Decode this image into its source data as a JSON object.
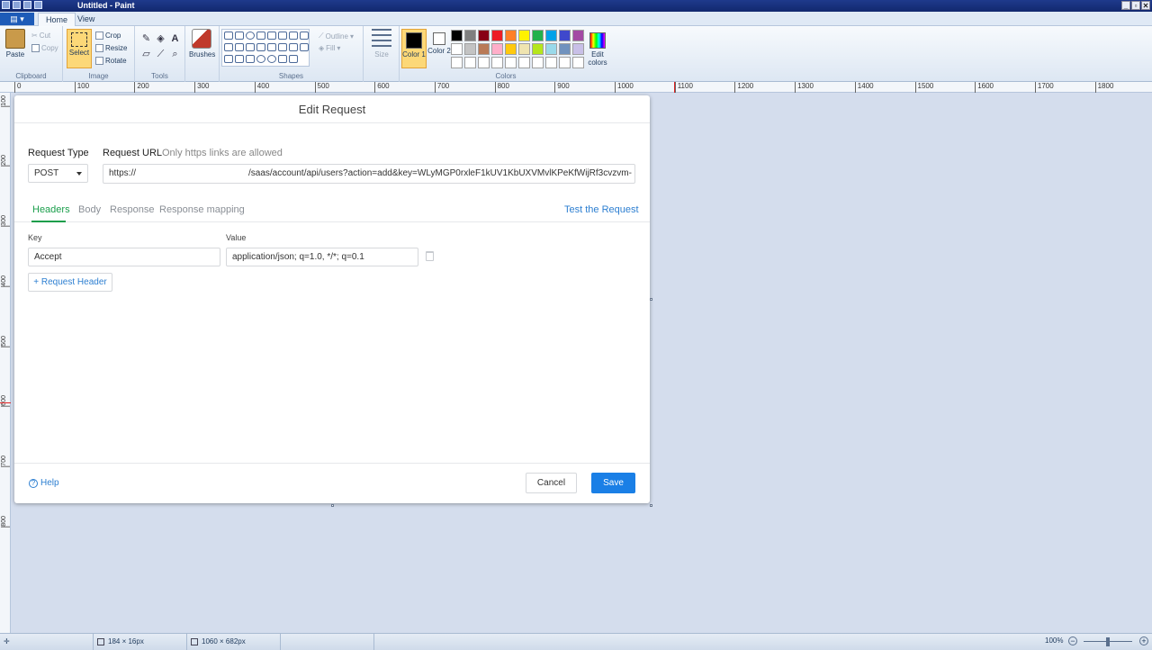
{
  "window": {
    "title": "Untitled - Paint",
    "controls": [
      "_",
      "▫",
      "✕"
    ]
  },
  "ribbon": {
    "file_menu_icon": "paint-menu-icon",
    "tabs": [
      {
        "label": "Home",
        "active": true
      },
      {
        "label": "View",
        "active": false
      }
    ],
    "groups": {
      "clipboard": {
        "label": "Clipboard",
        "paste": "Paste",
        "cut": "Cut",
        "copy": "Copy"
      },
      "image": {
        "label": "Image",
        "select": "Select",
        "crop": "Crop",
        "resize": "Resize",
        "rotate": "Rotate"
      },
      "tools": {
        "label": "Tools"
      },
      "brushes": {
        "label": "Brushes"
      },
      "shapes": {
        "label": "Shapes",
        "outline": "Outline",
        "fill": "Fill"
      },
      "size": {
        "label": "Size"
      },
      "colors": {
        "label": "Colors",
        "color1": "Color 1",
        "color2": "Color 2",
        "edit": "Edit colors",
        "palette_row1": [
          "#000000",
          "#7f7f7f",
          "#880015",
          "#ed1c24",
          "#ff7f27",
          "#fff200",
          "#22b14c",
          "#00a2e8",
          "#3f48cc",
          "#a349a4"
        ],
        "palette_row2": [
          "#ffffff",
          "#c3c3c3",
          "#b97a57",
          "#ffaec9",
          "#ffc90e",
          "#efe4b0",
          "#b5e61d",
          "#99d9ea",
          "#7092be",
          "#c8bfe7"
        ],
        "palette_row3": [
          "#ffffff",
          "#ffffff",
          "#ffffff",
          "#ffffff",
          "#ffffff",
          "#ffffff",
          "#ffffff",
          "#ffffff",
          "#ffffff",
          "#ffffff"
        ]
      }
    }
  },
  "rulers": {
    "h_ticks": [
      "0",
      "100",
      "200",
      "300",
      "400",
      "500",
      "600",
      "700",
      "800",
      "900",
      "1000",
      "1100",
      "1200",
      "1300",
      "1400",
      "1500",
      "1600",
      "1700",
      "1800"
    ],
    "v_ticks": [
      "100",
      "200",
      "300",
      "400",
      "500",
      "600",
      "700",
      "800"
    ]
  },
  "dialog": {
    "title": "Edit Request",
    "request_type_label": "Request Type",
    "request_type_value": "POST",
    "request_url_label": "Request URL",
    "request_url_hint": "Only https links are allowed",
    "url_prefix": "https://",
    "url_middle": "_",
    "url_rest": "/saas/account/api/users?action=add&key=WLyMGP0rxleF1kUV1KbUXVMvlKPeKfWijRf3cvzvm-",
    "tabs": [
      "Headers",
      "Body",
      "Response",
      "Response mapping"
    ],
    "test_link": "Test the Request",
    "key_label": "Key",
    "value_label": "Value",
    "key_value": "Accept",
    "value_value": "application/json; q=1.0, */*; q=0.1",
    "add_header": "+ Request Header",
    "help": "Help",
    "cancel": "Cancel",
    "save": "Save"
  },
  "statusbar": {
    "selection_size": "184 × 16px",
    "canvas_size": "1060 × 682px",
    "zoom": "100%"
  }
}
